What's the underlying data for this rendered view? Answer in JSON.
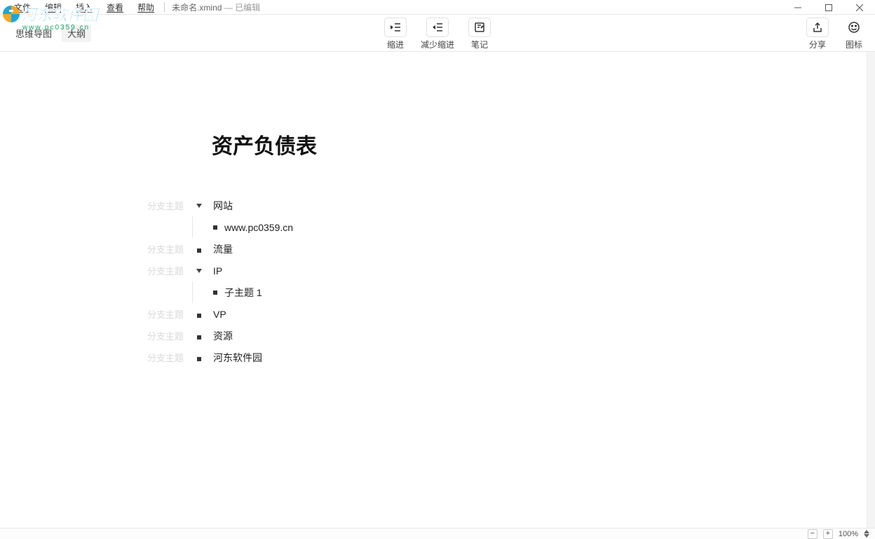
{
  "menu": {
    "file": "文件",
    "edit": "编辑",
    "insert": "插入",
    "view": "查看",
    "help": "帮助"
  },
  "document": {
    "name": "未命名.xmind",
    "edited": "已编辑"
  },
  "tabs": {
    "mindmap": "思维导图",
    "outline": "大纲"
  },
  "toolbar": {
    "indent": "缩进",
    "outdent": "减少缩进",
    "note": "笔记",
    "share": "分享",
    "icons": "图标"
  },
  "outline": {
    "title": "资产负债表",
    "branch_hint": "分支主题",
    "items": [
      {
        "label": "网站",
        "expandable": true,
        "children": [
          {
            "label": "www.pc0359.cn"
          }
        ]
      },
      {
        "label": "流量",
        "expandable": false
      },
      {
        "label": "IP",
        "expandable": true,
        "children": [
          {
            "label": "子主题 1"
          }
        ]
      },
      {
        "label": "VP",
        "expandable": false
      },
      {
        "label": "资源",
        "expandable": false
      },
      {
        "label": "河东软件园",
        "expandable": false
      }
    ]
  },
  "status": {
    "zoom": "100%"
  },
  "watermark": {
    "text": "河东软件园",
    "url": "www.pc0359.cn"
  }
}
